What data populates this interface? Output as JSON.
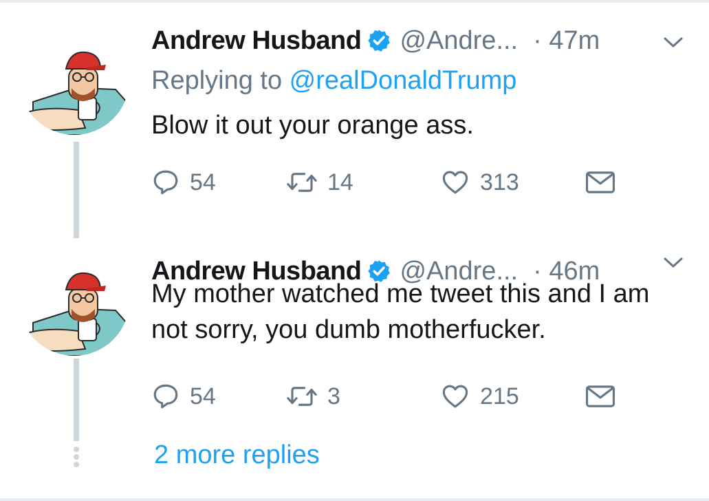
{
  "colors": {
    "text": "#14171a",
    "secondary": "#657786",
    "link": "#1da1f2",
    "verified": "#1da1f2",
    "thread_line": "#ccd6dd"
  },
  "tweets": [
    {
      "display_name": "Andrew Husband",
      "verified_icon": "verified-badge-icon",
      "handle": "@Andre...",
      "time": "· 47m",
      "replying_prefix": "Replying to ",
      "replying_mention": "@realDonaldTrump",
      "text": "Blow it out your orange ass.",
      "replies": "54",
      "retweets": "14",
      "likes": "313"
    },
    {
      "display_name": "Andrew Husband",
      "verified_icon": "verified-badge-icon",
      "handle": "@Andre...",
      "time": "· 46m",
      "text": "My mother watched me tweet this and I am not sorry, you dumb motherfucker.",
      "replies": "54",
      "retweets": "3",
      "likes": "215"
    }
  ],
  "more_replies": "2 more replies"
}
